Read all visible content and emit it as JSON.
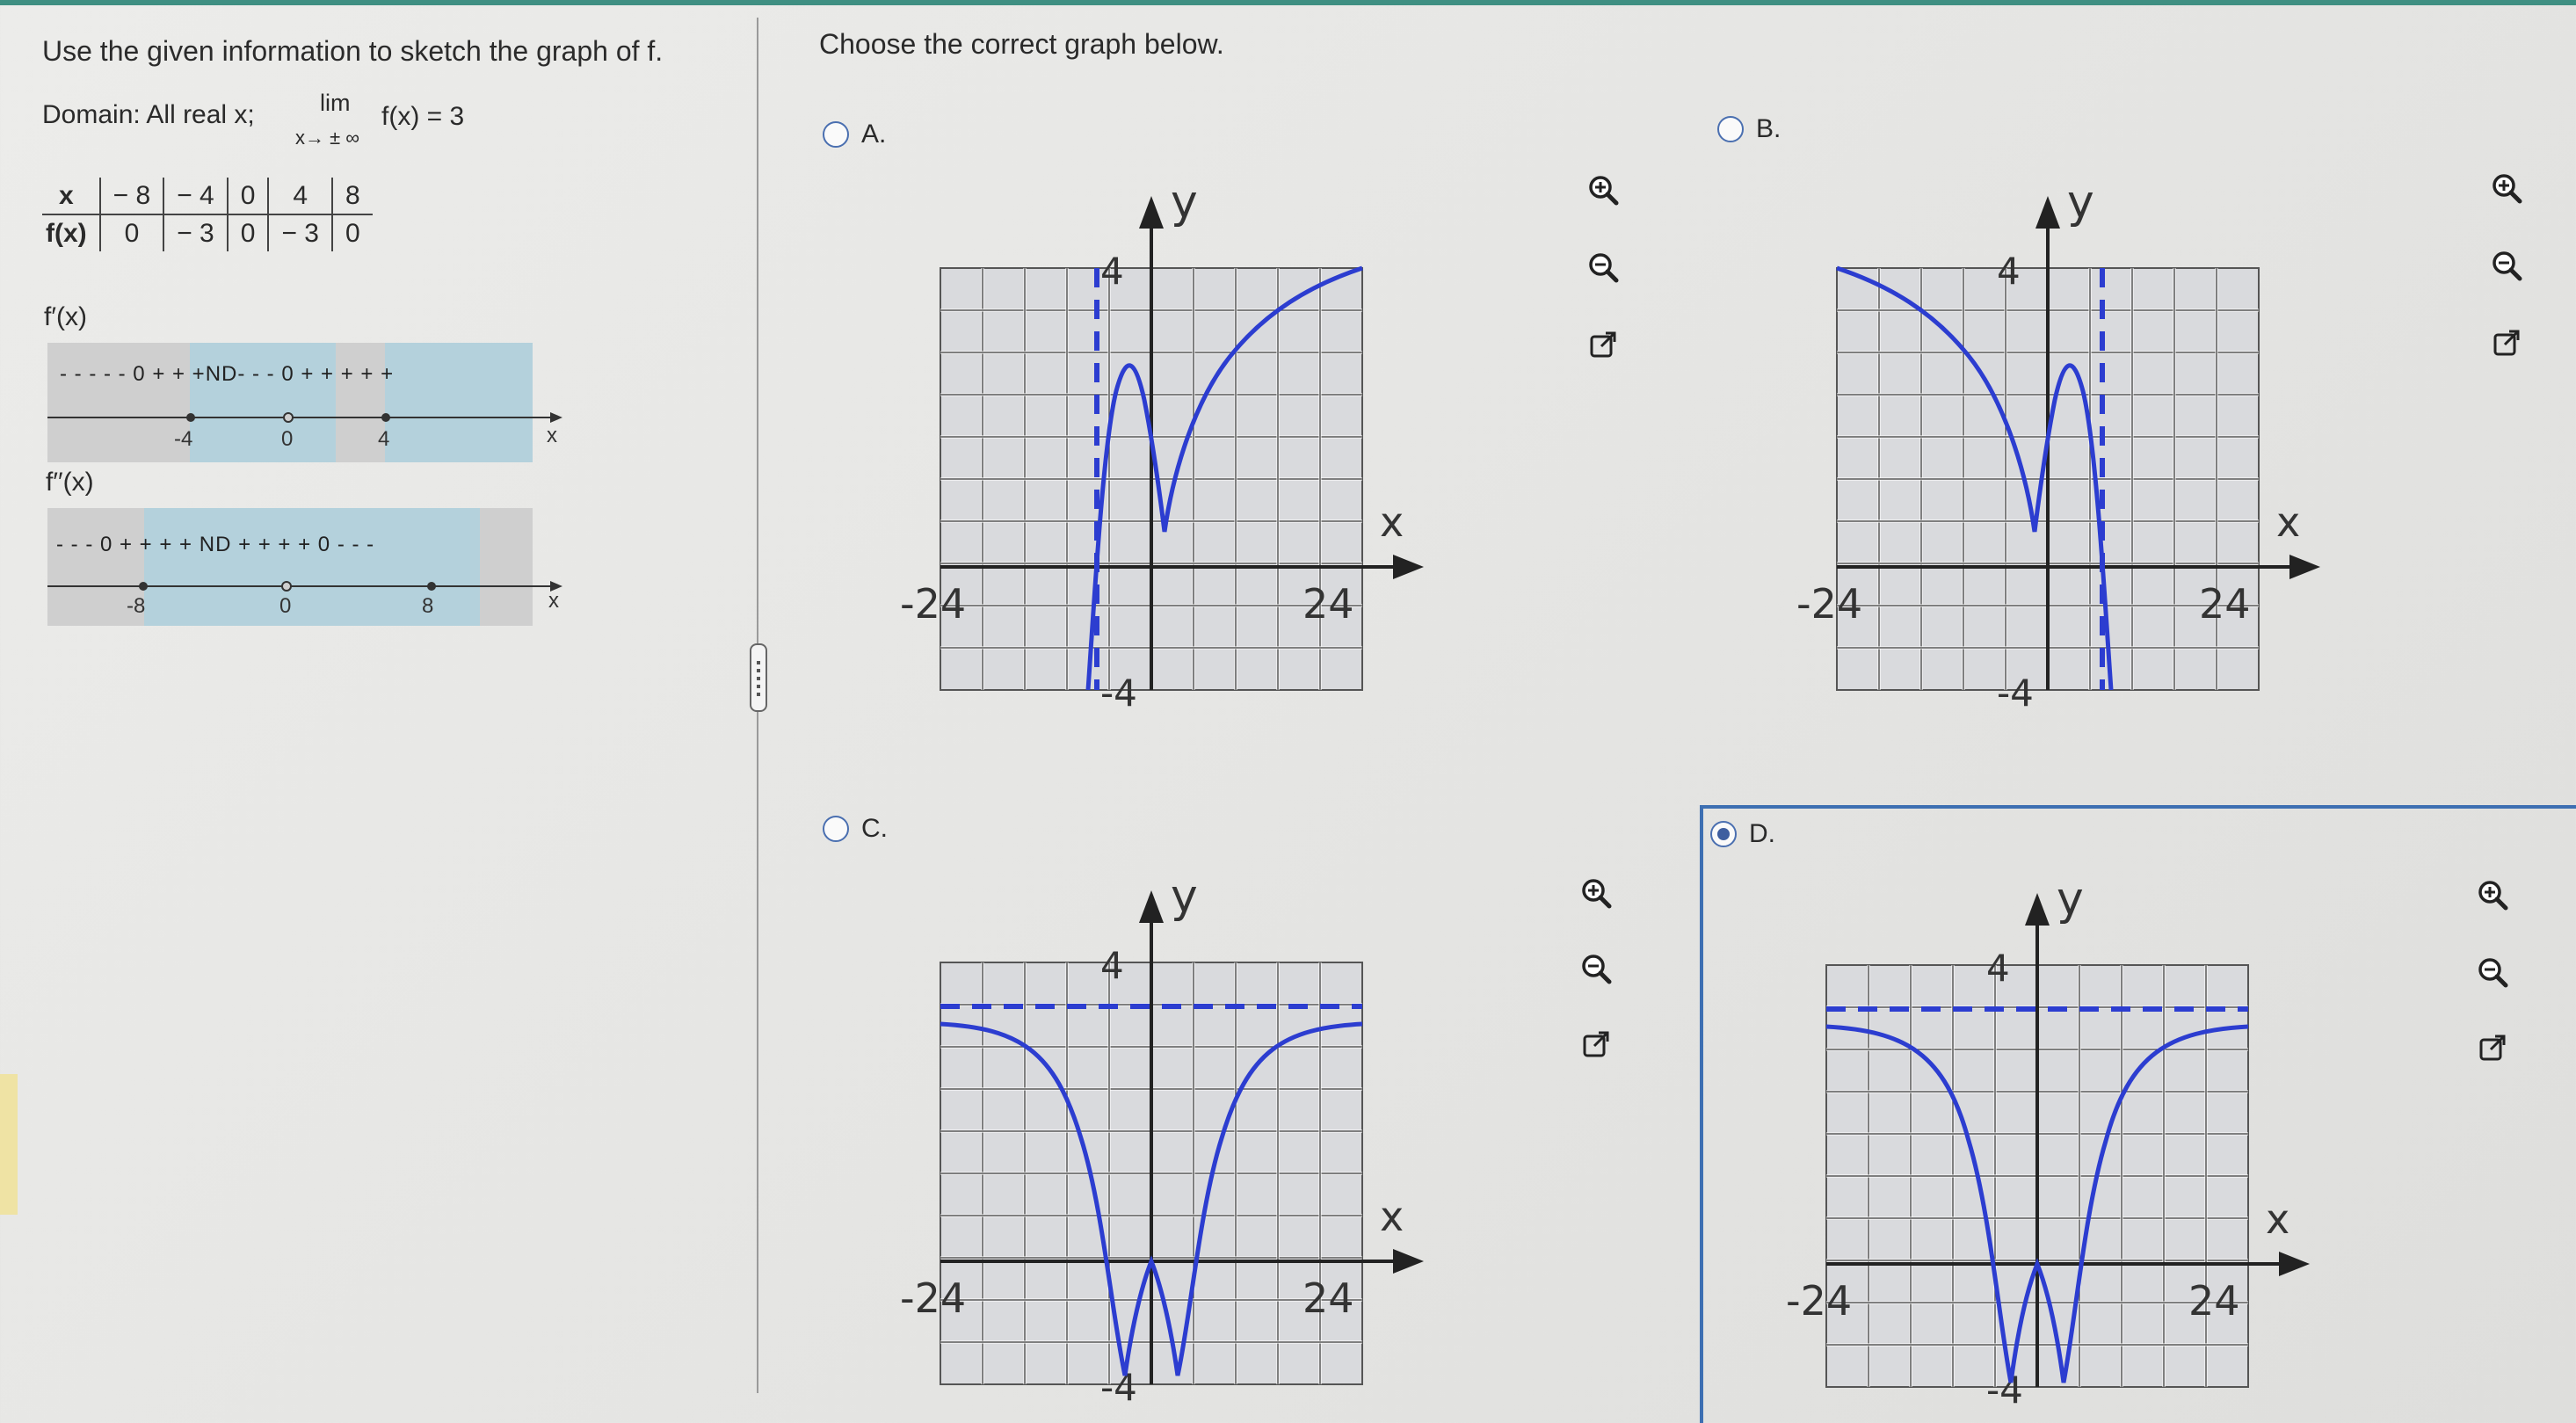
{
  "question": {
    "instruction": "Use the given information to sketch the graph of f.",
    "domain_text": "Domain: All real x;",
    "limit": {
      "word": "lim",
      "sub": "x→ ± ∞",
      "expr": "f(x) = 3"
    },
    "table": {
      "row_x": [
        "x",
        "− 8",
        "− 4",
        "0",
        "4",
        "8"
      ],
      "row_f": [
        "f(x)",
        "0",
        "− 3",
        "0",
        "− 3",
        "0"
      ]
    },
    "fprime": {
      "label": "f′(x)",
      "signs": "- - - - - 0 + + +ND- - - 0 + + + + +",
      "ticks": [
        "-4",
        "0",
        "4"
      ],
      "axis_var": "x"
    },
    "fdoubleprime": {
      "label": "f′′(x)",
      "signs": "- - - 0 + + + + ND + + + + 0 - - -",
      "ticks": [
        "-8",
        "0",
        "8"
      ],
      "axis_var": "x"
    }
  },
  "answer": {
    "prompt": "Choose the correct graph below.",
    "selected": "D",
    "options": [
      {
        "id": "A",
        "label": "A.",
        "selected": false
      },
      {
        "id": "B",
        "label": "B.",
        "selected": false
      },
      {
        "id": "C",
        "label": "C.",
        "selected": false
      },
      {
        "id": "D",
        "label": "D.",
        "selected": true
      }
    ],
    "graph_labels": {
      "y_axis": "y",
      "x_axis": "x",
      "y_tick": "4",
      "y_tick_neg": "-4",
      "x_tick_neg": "-24",
      "x_tick_pos": "24"
    },
    "tools": [
      "zoom-in-icon",
      "zoom-out-icon",
      "open-external-icon"
    ]
  },
  "colors": {
    "curve": "#2c3dd0",
    "asymptote": "#2c3dd0",
    "grid_bg": "#d9dadd",
    "grid_line": "#ffffff",
    "selection": "#3d6fb2",
    "highlight": "#b4d1dc"
  }
}
